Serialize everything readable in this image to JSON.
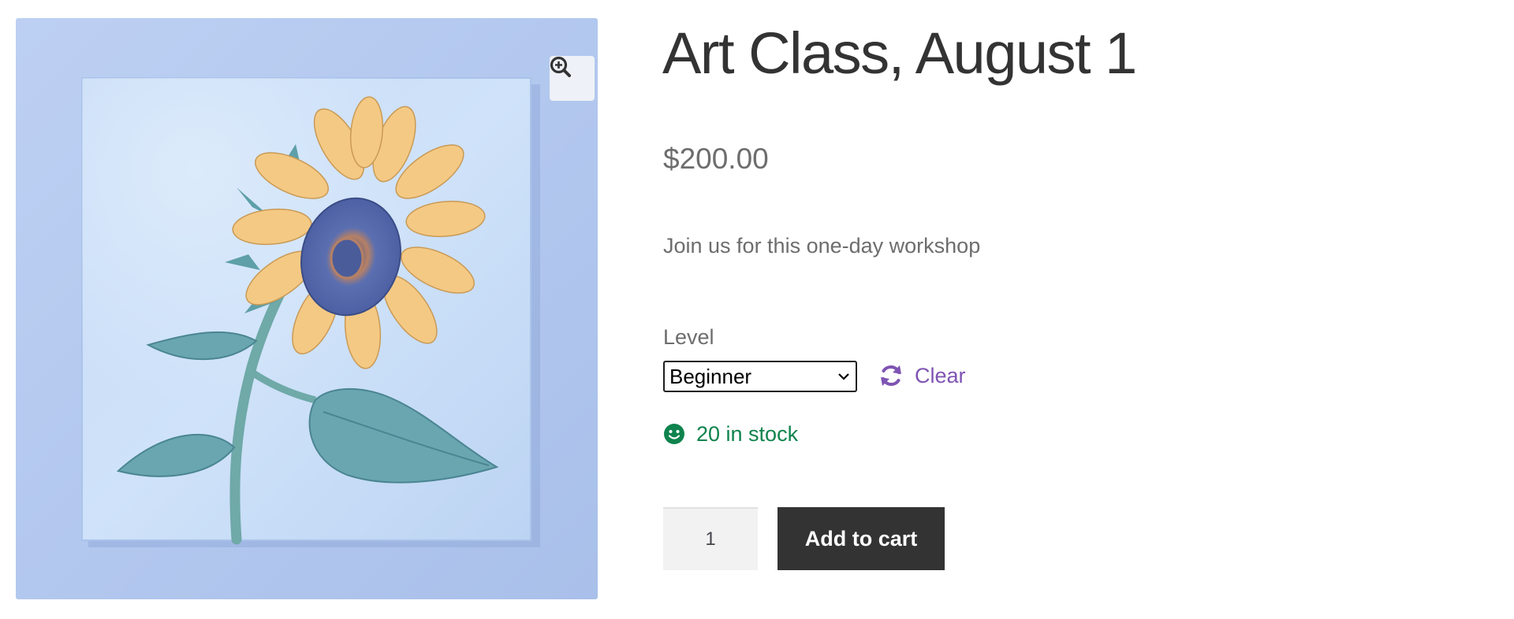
{
  "product": {
    "title": "Art Class, August 1",
    "price": "$200.00",
    "description": "Join us for this one-day workshop",
    "image": {
      "subject": "sunflower-painting",
      "background_color": "#b8ccf1"
    }
  },
  "variation": {
    "label": "Level",
    "selected": "Beginner",
    "clear_label": "Clear"
  },
  "stock": {
    "text": "20 in stock",
    "color": "#0f834d"
  },
  "cart": {
    "quantity": "1",
    "add_to_cart_label": "Add to cart"
  },
  "colors": {
    "accent": "#7f54b3",
    "button": "#333333"
  },
  "icons": {
    "zoom": "zoom-in-icon",
    "clear": "refresh-icon",
    "stock": "smiley-icon",
    "select": "chevron-down-icon"
  }
}
